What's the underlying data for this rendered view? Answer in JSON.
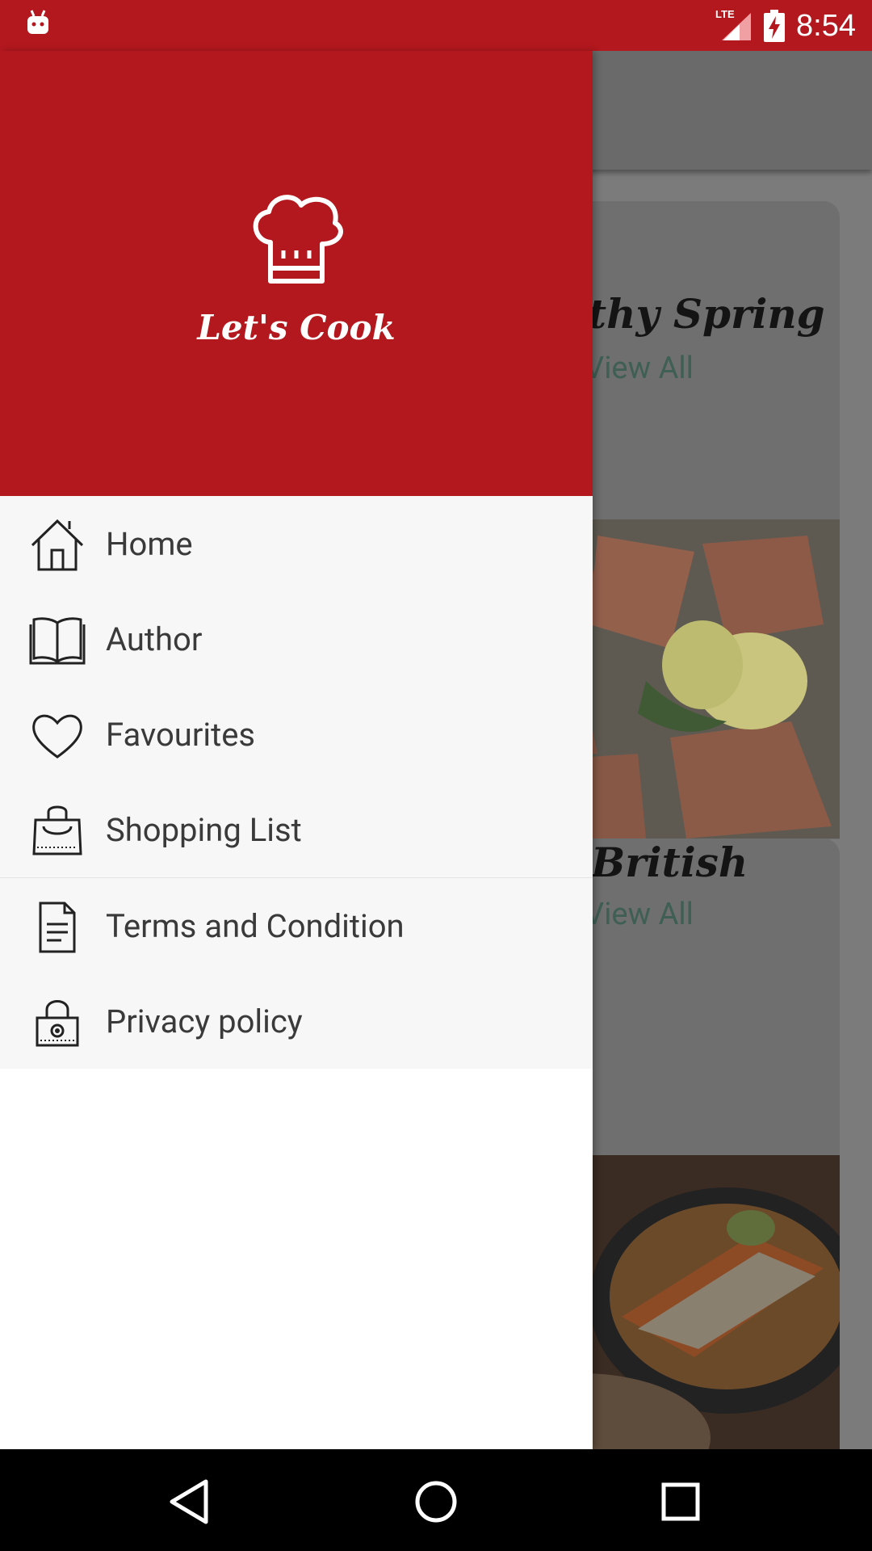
{
  "status_bar": {
    "time": "8:54",
    "network": "LTE",
    "colors": {
      "background": "#b3181e"
    }
  },
  "drawer": {
    "app_title": "Let's Cook",
    "header_color": "#b3181e",
    "items": [
      {
        "label": "Home",
        "icon": "home-icon"
      },
      {
        "label": "Author",
        "icon": "book-icon"
      },
      {
        "label": "Favourites",
        "icon": "heart-icon"
      },
      {
        "label": "Shopping List",
        "icon": "shopping-bag-icon"
      },
      {
        "label": "Terms and Condition",
        "icon": "document-icon"
      },
      {
        "label": "Privacy policy",
        "icon": "lock-icon"
      }
    ]
  },
  "background": {
    "cards": [
      {
        "title": "thy Spring",
        "link": "View All"
      },
      {
        "title": "British",
        "link": "View All"
      }
    ]
  },
  "nav_bar": {
    "buttons": [
      "back-icon",
      "home-circle-icon",
      "recents-icon"
    ]
  }
}
